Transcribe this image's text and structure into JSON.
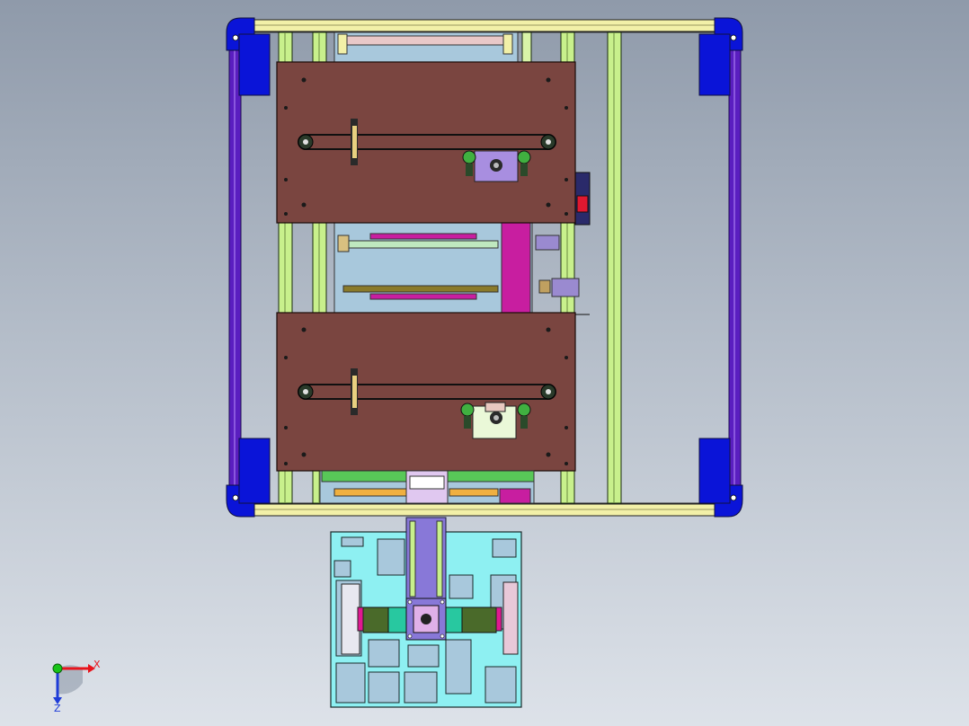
{
  "viewport": {
    "background_top": "#8f9aaa",
    "background_bottom": "#dde2e9"
  },
  "triad": {
    "x_label": "X",
    "z_label": "Z",
    "x_color": "#e8141c",
    "y_color": "#18c418",
    "z_color": "#1e3cd8"
  },
  "colors": {
    "frame_blue": "#0a14d8",
    "frame_purple": "#5a1ec0",
    "rail_yellow": "#f2f0a8",
    "upright_green": "#c8f08c",
    "plate_brown": "#7a4540",
    "magenta": "#c81ea0",
    "lilac": "#a88ee0",
    "cyan_plate": "#8ef0f2",
    "olive": "#4a6a2a",
    "teal": "#28c8a0",
    "inner_bg": "#a8c8dc"
  },
  "icons": {
    "triad": "coordinate-axes-icon"
  }
}
